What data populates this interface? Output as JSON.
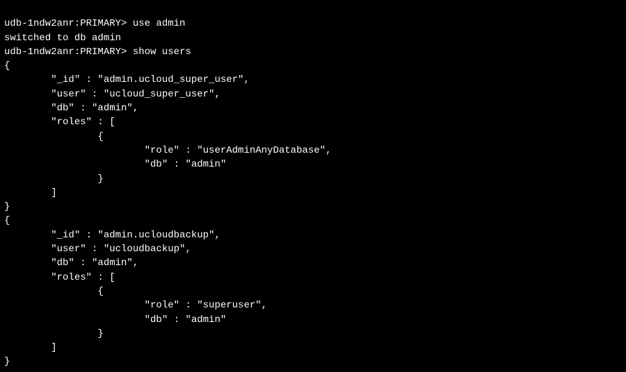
{
  "lines": [
    "udb-1ndw2anr:PRIMARY> use admin",
    "switched to db admin",
    "udb-1ndw2anr:PRIMARY> show users",
    "{",
    "        \"_id\" : \"admin.ucloud_super_user\",",
    "        \"user\" : \"ucloud_super_user\",",
    "        \"db\" : \"admin\",",
    "        \"roles\" : [",
    "                {",
    "                        \"role\" : \"userAdminAnyDatabase\",",
    "                        \"db\" : \"admin\"",
    "                }",
    "        ]",
    "}",
    "{",
    "        \"_id\" : \"admin.ucloudbackup\",",
    "        \"user\" : \"ucloudbackup\",",
    "        \"db\" : \"admin\",",
    "        \"roles\" : [",
    "                {",
    "                        \"role\" : \"superuser\",",
    "                        \"db\" : \"admin\"",
    "                }",
    "        ]",
    "}"
  ]
}
